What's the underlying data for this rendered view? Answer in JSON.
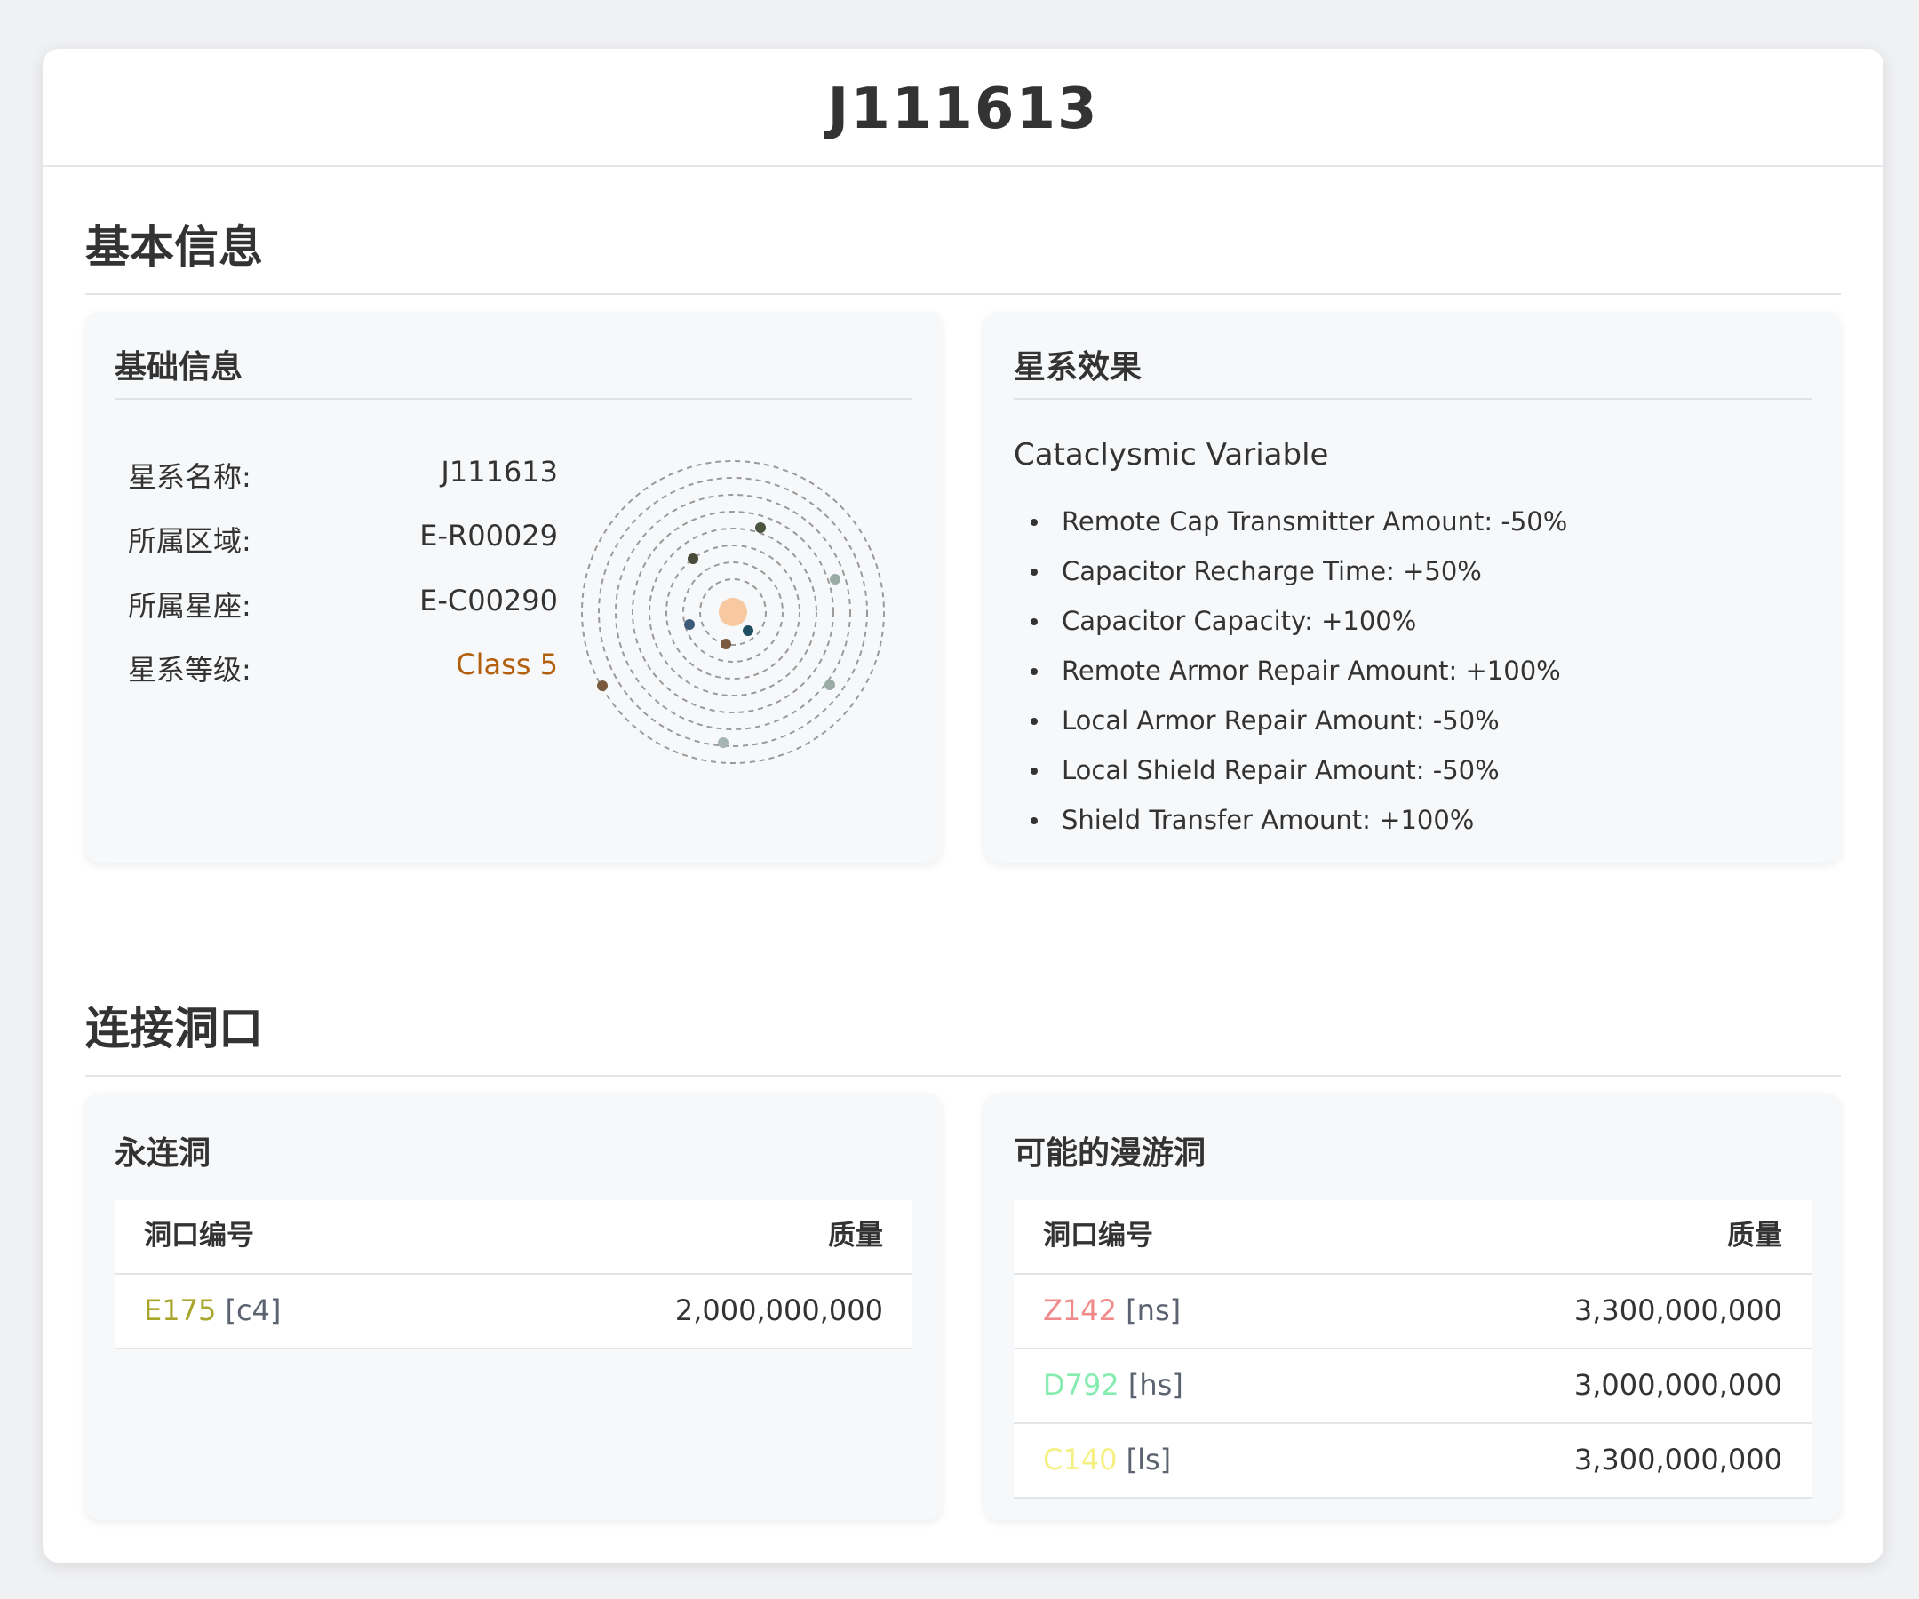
{
  "title": "J111613",
  "basic_section": {
    "title": "基本信息",
    "info_panel": {
      "title": "基础信息",
      "rows": [
        {
          "label": "星系名称:",
          "value": "J111613"
        },
        {
          "label": "所属区域:",
          "value": "E-R00029"
        },
        {
          "label": "所属星座:",
          "value": "E-C00290"
        },
        {
          "label": "星系等级:",
          "value": "Class 5"
        }
      ],
      "class_color": "#b3600d"
    },
    "effects_panel": {
      "title": "星系效果",
      "effect_name": "Cataclysmic Variable",
      "effects": [
        "Remote Cap Transmitter Amount: -50%",
        "Capacitor Recharge Time: +50%",
        "Capacitor Capacity: +100%",
        "Remote Armor Repair Amount: +100%",
        "Local Armor Repair Amount: -50%",
        "Local Shield Repair Amount: -50%",
        "Shield Transfer Amount: +100%"
      ]
    }
  },
  "wormhole_section": {
    "title": "连接洞口",
    "static_panel": {
      "title": "永连洞",
      "headers": {
        "code": "洞口编号",
        "mass": "质量"
      },
      "rows": [
        {
          "code": "E175",
          "type": "[c4]",
          "mass": "2,000,000,000",
          "color": "#a8a62a"
        }
      ]
    },
    "wandering_panel": {
      "title": "可能的漫游洞",
      "headers": {
        "code": "洞口编号",
        "mass": "质量"
      },
      "rows": [
        {
          "code": "Z142",
          "type": "[ns]",
          "mass": "3,300,000,000",
          "color": "#f08a8a"
        },
        {
          "code": "D792",
          "type": "[hs]",
          "mass": "3,000,000,000",
          "color": "#86ecb0"
        },
        {
          "code": "C140",
          "type": "[ls]",
          "mass": "3,300,000,000",
          "color": "#f5f084"
        }
      ]
    }
  },
  "orbit_icon": {
    "star_color": "#f8c8a0",
    "ring_color": "#9a9a9a"
  }
}
